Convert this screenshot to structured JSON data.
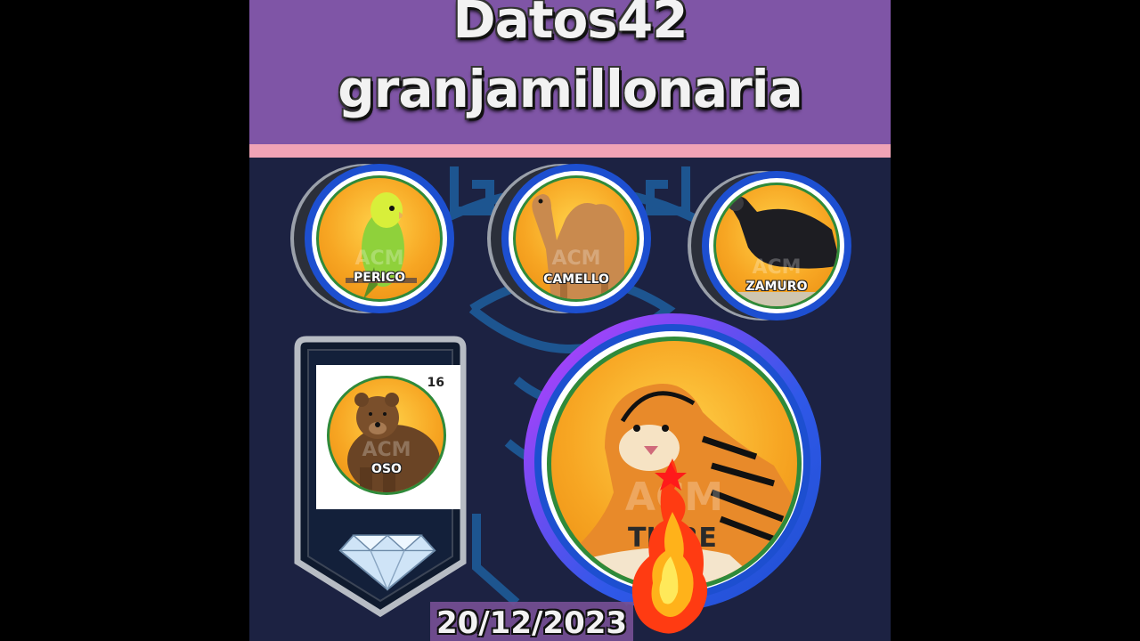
{
  "header": {
    "title_line_1": "Datos42",
    "title_line_2": "granjamillonaria"
  },
  "results": [
    {
      "label": "PERICO",
      "watermark": "ACM"
    },
    {
      "label": "CAMELLO",
      "watermark": "ACM"
    },
    {
      "label": "ZAMURO",
      "watermark": "ACM"
    }
  ],
  "featured_card": {
    "label": "OSO",
    "number": "16",
    "watermark": "ACM",
    "icon": "diamond-icon"
  },
  "main_pick": {
    "label": "TIGRE",
    "watermark": "ACM",
    "icon": "fire-icon"
  },
  "date": "20/12/2023",
  "colors": {
    "header_purple": "#7f55a6",
    "stripe_pink": "#f0a3b6",
    "background_navy": "#1c2242",
    "ring_blue": "#1d4fd0",
    "ring_purple": "#b43cff",
    "medal_orange": "#f7a623"
  }
}
